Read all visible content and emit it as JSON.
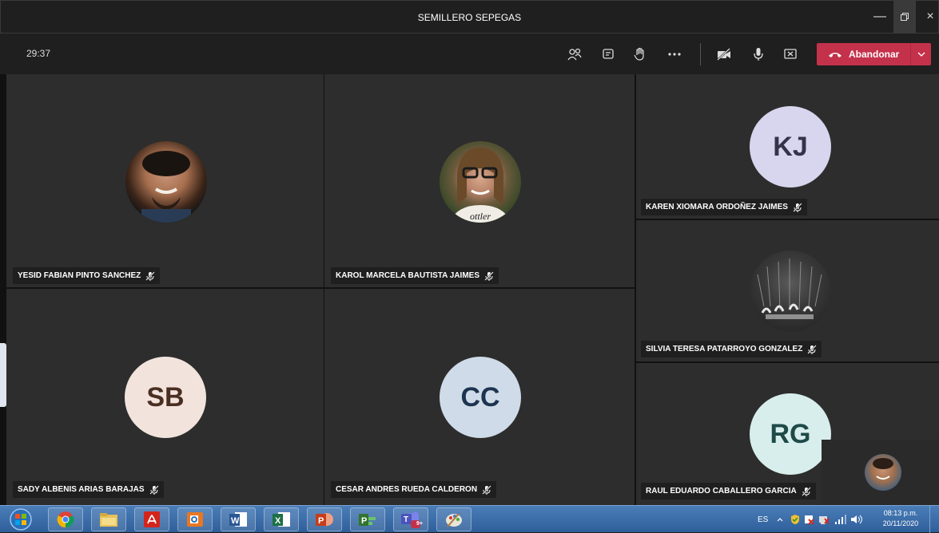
{
  "window": {
    "title": "SEMILLERO SEPEGAS"
  },
  "meeting": {
    "timer": "29:37",
    "leave_label": "Abandonar"
  },
  "participants": [
    {
      "name": "YESID FABIAN PINTO SANCHEZ",
      "initials": "",
      "has_photo": true
    },
    {
      "name": "KAROL MARCELA BAUTISTA JAIMES",
      "initials": "",
      "has_photo": true
    },
    {
      "name": "KAREN XIOMARA ORDOÑEZ JAIMES",
      "initials": "KJ",
      "avatar_color": "#d8d6ee",
      "text_color": "#33344a"
    },
    {
      "name": "SILVIA TERESA PATARROYO GONZALEZ",
      "initials": "",
      "has_photo": true
    },
    {
      "name": "SADY ALBENIS ARIAS BARAJAS",
      "initials": "SB",
      "avatar_color": "#f2e4dc",
      "text_color": "#4a2e22"
    },
    {
      "name": "CESAR ANDRES RUEDA CALDERON",
      "initials": "CC",
      "avatar_color": "#cfdbe8",
      "text_color": "#1d3450"
    },
    {
      "name": "RAUL EDUARDO CABALLERO GARCIA",
      "initials": "RG",
      "avatar_color": "#d8eeec",
      "text_color": "#1e4a47"
    }
  ],
  "taskbar": {
    "language": "ES",
    "time": "08:13 p.m.",
    "date": "20/11/2020",
    "apps": [
      "start-orb",
      "chrome",
      "file-explorer",
      "acrobat",
      "outlook",
      "word",
      "excel",
      "powerpoint",
      "project",
      "teams",
      "paint"
    ],
    "teams_badge": "9+"
  },
  "colors": {
    "leave": "#c4314b",
    "tile": "#2d2d2d",
    "background": "#1f1f1f"
  }
}
